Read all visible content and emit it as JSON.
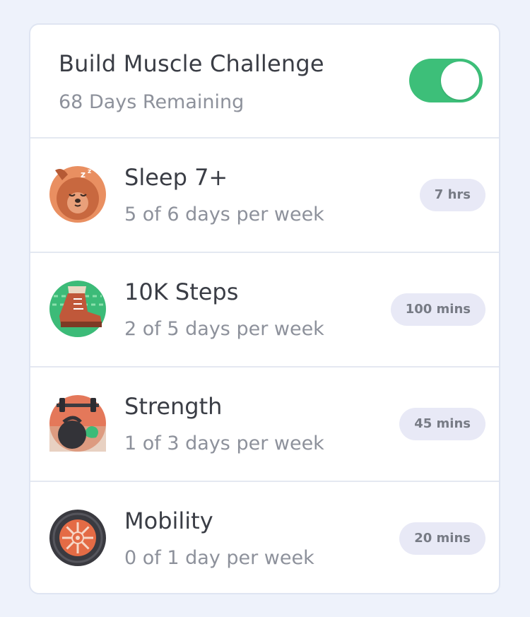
{
  "challenge": {
    "title": "Build Muscle Challenge",
    "subtitle": "68 Days Remaining",
    "enabled": true,
    "toggle_color": "#3dbf79"
  },
  "habits": [
    {
      "name": "Sleep 7+",
      "progress": "5 of 6 days per week",
      "target": "7 hrs",
      "icon": "sleeping-bear-icon"
    },
    {
      "name": "10K Steps",
      "progress": "2 of 5 days per week",
      "target": "100 mins",
      "icon": "hiking-boot-icon"
    },
    {
      "name": "Strength",
      "progress": "1 of 3 days per week",
      "target": "45 mins",
      "icon": "kettlebell-icon"
    },
    {
      "name": "Mobility",
      "progress": "0 of 1 day per week",
      "target": "20 mins",
      "icon": "wheel-icon"
    }
  ]
}
